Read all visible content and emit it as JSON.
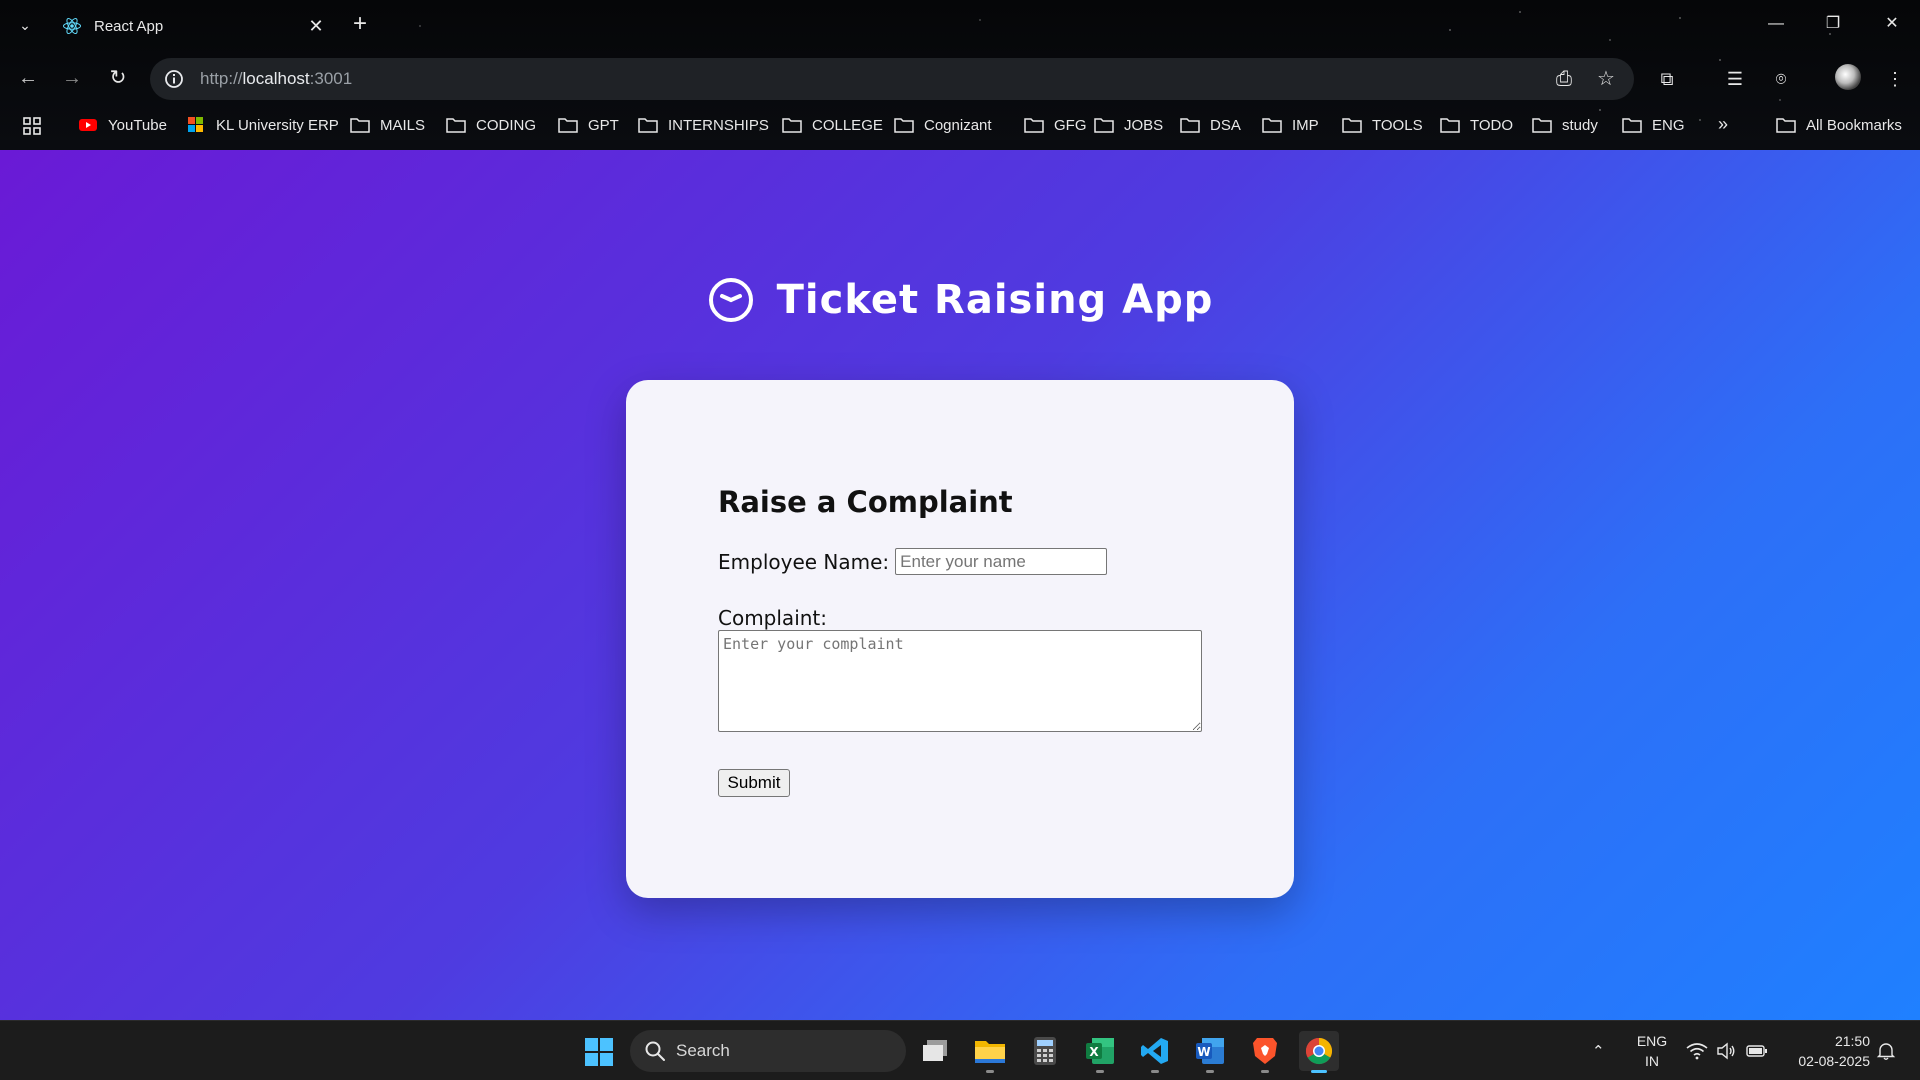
{
  "browser": {
    "tab_title": "React App",
    "url_prefix": "http://",
    "url_host": "localhost",
    "url_port": ":3001",
    "bookmarks": [
      {
        "label": "YouTube",
        "icon": "youtube-icon"
      },
      {
        "label": "KL University ERP",
        "icon": "windows-logo-icon"
      },
      {
        "label": "MAILS",
        "icon": "folder-icon"
      },
      {
        "label": "CODING",
        "icon": "folder-icon"
      },
      {
        "label": "GPT",
        "icon": "folder-icon"
      },
      {
        "label": "INTERNSHIPS",
        "icon": "folder-icon"
      },
      {
        "label": "COLLEGE",
        "icon": "folder-icon"
      },
      {
        "label": "Cognizant",
        "icon": "folder-icon"
      },
      {
        "label": "GFG",
        "icon": "folder-icon"
      },
      {
        "label": "JOBS",
        "icon": "folder-icon"
      },
      {
        "label": "DSA",
        "icon": "folder-icon"
      },
      {
        "label": "IMP",
        "icon": "folder-icon"
      },
      {
        "label": "TOOLS",
        "icon": "folder-icon"
      },
      {
        "label": "TODO",
        "icon": "folder-icon"
      },
      {
        "label": "study",
        "icon": "folder-icon"
      },
      {
        "label": "ENG",
        "icon": "folder-icon"
      }
    ],
    "all_bookmarks": "All Bookmarks"
  },
  "app": {
    "title": "Ticket Raising App",
    "form_heading": "Raise a Complaint",
    "name_label": "Employee Name:",
    "name_placeholder": "Enter your name",
    "complaint_label": "Complaint:",
    "complaint_placeholder": "Enter your complaint",
    "submit_label": "Submit"
  },
  "taskbar": {
    "search_label": "Search",
    "lang_line1": "ENG",
    "lang_line2": "IN",
    "time": "21:50",
    "date": "02-08-2025"
  },
  "colors": {
    "page_gradient_start": "#6a1ad6",
    "page_gradient_end": "#1f80ff",
    "card_bg": "#f5f4fb"
  }
}
